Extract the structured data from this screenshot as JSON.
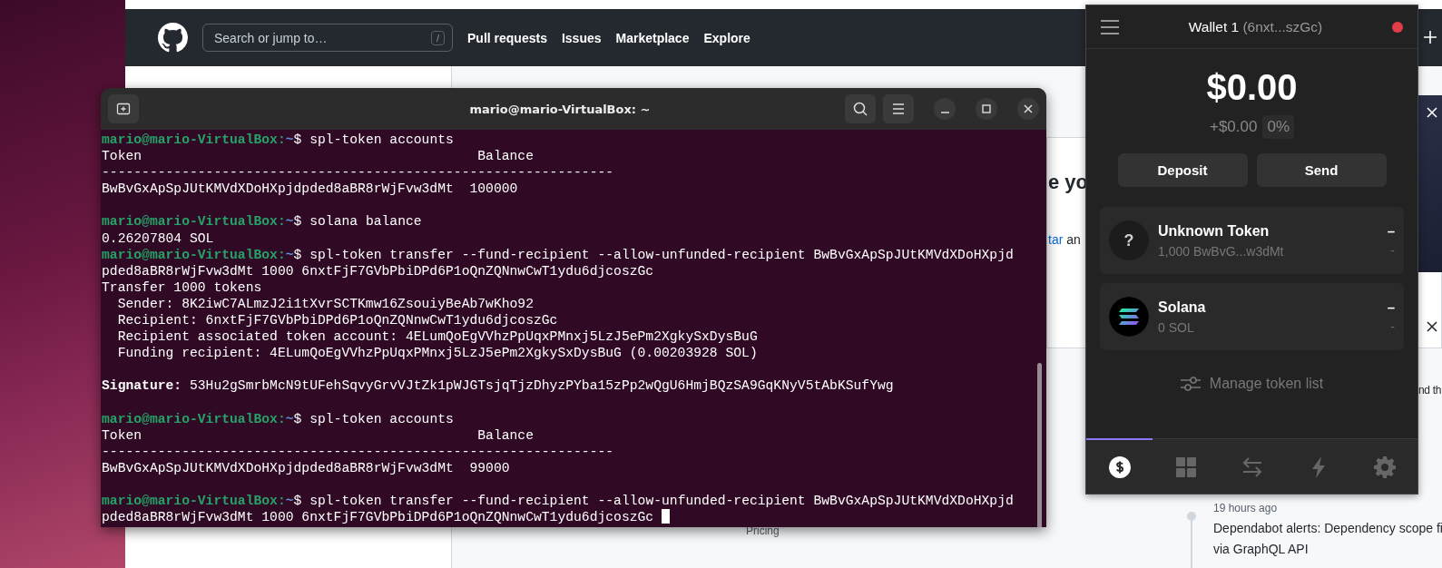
{
  "browser": {
    "header": {
      "search": {
        "placeholder": "Search or jump to…",
        "shortcut": "/"
      },
      "nav": [
        "Pull requests",
        "Issues",
        "Marketplace",
        "Explore"
      ]
    },
    "page": {
      "heading_fragment": "e yo",
      "link_fragment": "tar",
      "text_fragment": "an",
      "side_fragment": "nd th",
      "footer_link": "Pricing",
      "feed": {
        "time": "19 hours ago",
        "title_lines": [
          "Dependabot alerts: Dependency scope fi",
          "via GraphQL API"
        ]
      }
    }
  },
  "terminal": {
    "title": "mario@mario-VirtualBox: ~",
    "cursor_visible": true,
    "lines": [
      {
        "kind": "prompt",
        "user_host": "mario@mario-VirtualBox:",
        "path": "~",
        "command": "$ spl-token accounts"
      },
      {
        "kind": "output",
        "text": "Token                                          Balance"
      },
      {
        "kind": "output",
        "text": "----------------------------------------------------------------"
      },
      {
        "kind": "output",
        "text": "BwBvGxApSpJUtKMVdXDoHXpjdpded8aBR8rWjFvw3dMt  100000"
      },
      {
        "kind": "blank"
      },
      {
        "kind": "prompt",
        "user_host": "mario@mario-VirtualBox:",
        "path": "~",
        "command": "$ solana balance"
      },
      {
        "kind": "output",
        "text": "0.26207804 SOL"
      },
      {
        "kind": "prompt",
        "user_host": "mario@mario-VirtualBox:",
        "path": "~",
        "command": "$ spl-token transfer --fund-recipient --allow-unfunded-recipient BwBvGxApSpJUtKMVdXDoHXpjd"
      },
      {
        "kind": "output",
        "text": "pded8aBR8rWjFvw3dMt 1000 6nxtFjF7GVbPbiDPd6P1oQnZQNnwCwT1ydu6djcoszGc"
      },
      {
        "kind": "output",
        "text": "Transfer 1000 tokens"
      },
      {
        "kind": "output",
        "text": "  Sender: 8K2iwC7ALmzJ2i1tXvrSCTKmw16ZsouiyBeAb7wKho92"
      },
      {
        "kind": "output",
        "text": "  Recipient: 6nxtFjF7GVbPbiDPd6P1oQnZQNnwCwT1ydu6djcoszGc"
      },
      {
        "kind": "output",
        "text": "  Recipient associated token account: 4ELumQoEgVVhzPpUqxPMnxj5LzJ5ePm2XgkySxDysBuG"
      },
      {
        "kind": "output",
        "text": "  Funding recipient: 4ELumQoEgVVhzPpUqxPMnxj5LzJ5ePm2XgkySxDysBuG (0.00203928 SOL)"
      },
      {
        "kind": "blank"
      },
      {
        "kind": "output",
        "text": "**Signature:** 53Hu2gSmrbMcN9tUFehSqvyGrvVJtZk1pWJGTsjqTjzDhyzPYba15zPp2wQgU6HmjBQzSA9GqKNyV5tAbKSufYwg"
      },
      {
        "kind": "blank"
      },
      {
        "kind": "prompt",
        "user_host": "mario@mario-VirtualBox:",
        "path": "~",
        "command": "$ spl-token accounts"
      },
      {
        "kind": "output",
        "text": "Token                                          Balance"
      },
      {
        "kind": "output",
        "text": "----------------------------------------------------------------"
      },
      {
        "kind": "output",
        "text": "BwBvGxApSpJUtKMVdXDoHXpjdpded8aBR8rWjFvw3dMt  99000"
      },
      {
        "kind": "blank"
      },
      {
        "kind": "prompt",
        "user_host": "mario@mario-VirtualBox:",
        "path": "~",
        "command": "$ spl-token transfer --fund-recipient --allow-unfunded-recipient BwBvGxApSpJUtKMVdXDoHXpjd"
      },
      {
        "kind": "output",
        "text": "pded8aBR8rWjFvw3dMt 1000 6nxtFjF7GVbPbiDPd6P1oQnZQNnwCwT1ydu6djcoszGc"
      }
    ]
  },
  "wallet": {
    "name": "Wallet 1",
    "address": "(6nxt...szGc)",
    "balance": "$0.00",
    "change": "+$0.00",
    "change_percent": "0%",
    "buttons": [
      "Deposit",
      "Send"
    ],
    "tokens": [
      {
        "kind": "unknown",
        "glyph": "?",
        "name": "Unknown Token",
        "amount": "1,000 BwBvG...w3dMt",
        "value": "–",
        "value_change": "-"
      },
      {
        "kind": "solana",
        "name": "Solana",
        "amount": "0 SOL",
        "value": "–",
        "value_change": "-"
      }
    ],
    "manage_label": "Manage token list",
    "nav": [
      {
        "kind": "dollar",
        "selected": true
      },
      {
        "kind": "grid",
        "selected": false
      },
      {
        "kind": "swap",
        "selected": false
      },
      {
        "kind": "bolt",
        "selected": false
      },
      {
        "kind": "gear",
        "selected": false
      }
    ]
  }
}
